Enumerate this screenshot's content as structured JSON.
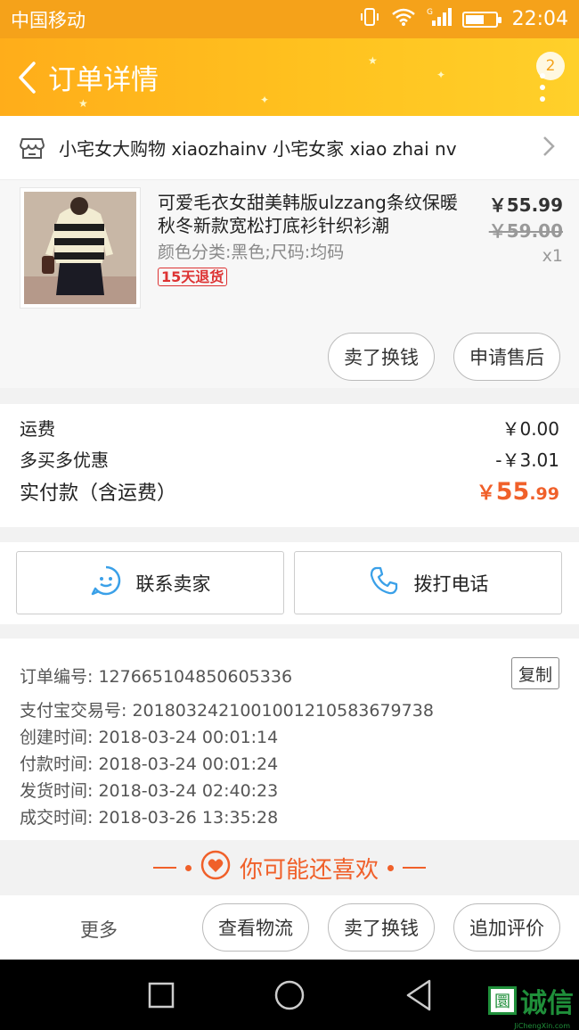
{
  "status_bar": {
    "carrier": "中国移动",
    "time": "22:04",
    "battery_level": 0.65
  },
  "header": {
    "title": "订单详情",
    "badge_count": "2"
  },
  "shop": {
    "name": "小宅女大购物 xiaozhainv 小宅女家 xiao zhai nv"
  },
  "product": {
    "title": "可爱毛衣女甜美韩版ulzzang条纹保暖秋冬新款宽松打底衫针织衫潮",
    "spec": "颜色分类:黑色;尺码:均码",
    "return_tag": "15天退货",
    "price": "￥55.99",
    "original_price": "￥59.00",
    "quantity": "x1",
    "btn_sell_exchange": "卖了换钱",
    "btn_after_sale": "申请售后"
  },
  "fees": {
    "shipping_label": "运费",
    "shipping_value": "￥0.00",
    "discount_label": "多买多优惠",
    "discount_value": "-￥3.01",
    "paid_label": "实付款（含运费）",
    "paid_currency": "￥",
    "paid_int": "55",
    "paid_dec": ".99"
  },
  "contact": {
    "seller": "联系卖家",
    "call": "拨打电话"
  },
  "order_info": {
    "order_no": "订单编号: 127665104850605336",
    "copy_label": "复制",
    "alipay_no": "支付宝交易号: 2018032421001001210583679738",
    "created": "创建时间: 2018-03-24 00:01:14",
    "paid": "付款时间: 2018-03-24 00:01:24",
    "shipped": "发货时间: 2018-03-24 02:40:23",
    "completed": "成交时间: 2018-03-26 13:35:28"
  },
  "recommend": {
    "title": "你可能还喜欢"
  },
  "actions": {
    "more": "更多",
    "logistics": "查看物流",
    "sell_exchange": "卖了换钱",
    "add_review": "追加评价"
  },
  "watermark": {
    "box": "圜",
    "text": "诚信",
    "sub": "JiChengXin.com"
  },
  "colors": {
    "accent": "#ffb31f",
    "price_red": "#f0602a",
    "contact_blue": "#3aa0e8"
  }
}
